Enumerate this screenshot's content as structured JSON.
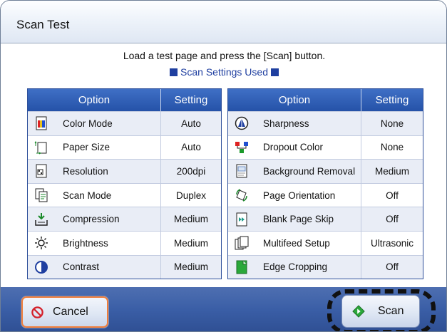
{
  "dialog": {
    "title": "Scan Test",
    "instruction": "Load a test page and press the [Scan] button.",
    "settings_used": "Scan Settings Used"
  },
  "left_table": {
    "header": {
      "option": "Option",
      "setting": "Setting"
    },
    "rows": [
      {
        "icon": "color-mode-icon",
        "option": "Color Mode",
        "setting": "Auto"
      },
      {
        "icon": "paper-size-icon",
        "option": "Paper Size",
        "setting": "Auto"
      },
      {
        "icon": "resolution-icon",
        "option": "Resolution",
        "setting": "200dpi"
      },
      {
        "icon": "scan-mode-icon",
        "option": "Scan Mode",
        "setting": "Duplex"
      },
      {
        "icon": "compression-icon",
        "option": "Compression",
        "setting": "Medium"
      },
      {
        "icon": "brightness-icon",
        "option": "Brightness",
        "setting": "Medium"
      },
      {
        "icon": "contrast-icon",
        "option": "Contrast",
        "setting": "Medium"
      }
    ]
  },
  "right_table": {
    "header": {
      "option": "Option",
      "setting": "Setting"
    },
    "rows": [
      {
        "icon": "sharpness-icon",
        "option": "Sharpness",
        "setting": "None"
      },
      {
        "icon": "dropout-color-icon",
        "option": "Dropout Color",
        "setting": "None"
      },
      {
        "icon": "background-removal-icon",
        "option": "Background Removal",
        "setting": "Medium"
      },
      {
        "icon": "page-orientation-icon",
        "option": "Page Orientation",
        "setting": "Off"
      },
      {
        "icon": "blank-page-skip-icon",
        "option": "Blank Page Skip",
        "setting": "Off"
      },
      {
        "icon": "multifeed-setup-icon",
        "option": "Multifeed Setup",
        "setting": "Ultrasonic"
      },
      {
        "icon": "edge-cropping-icon",
        "option": "Edge Cropping",
        "setting": "Off"
      }
    ]
  },
  "footer": {
    "cancel_label": "Cancel",
    "cancel_icon": "prohibit-icon",
    "scan_label": "Scan",
    "scan_icon": "diamond-start-icon"
  },
  "colors": {
    "header_blue": "#2d5bb3",
    "footer_blue": "#3a5ea6",
    "link_blue": "#1f3fa0",
    "focus_orange": "#f07d3a"
  }
}
